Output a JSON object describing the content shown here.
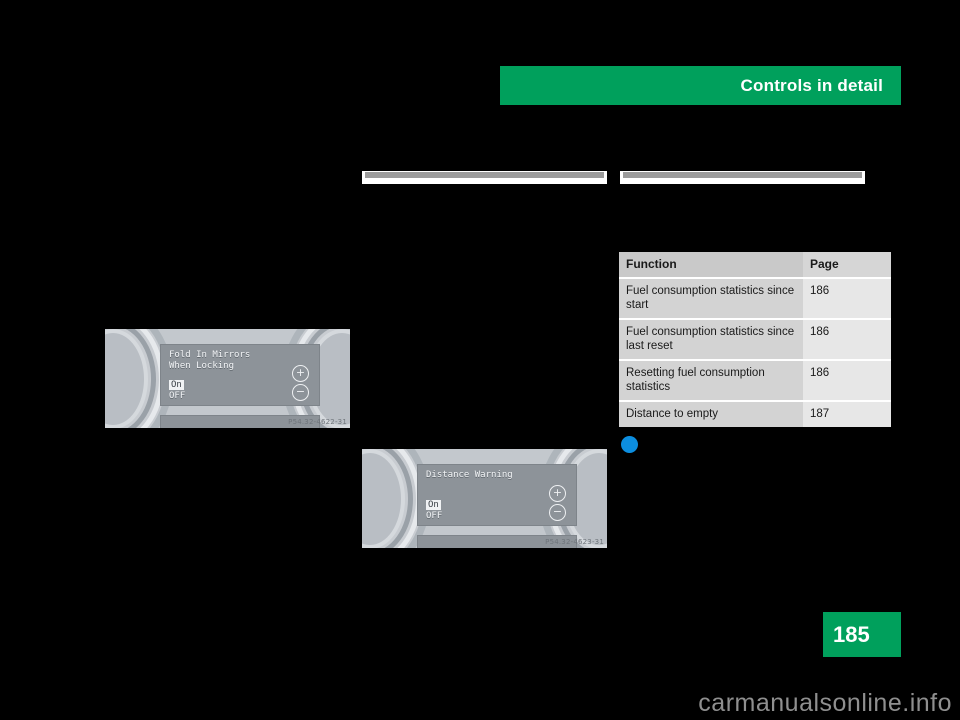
{
  "header": {
    "title": "Controls in detail"
  },
  "rules": {
    "middle_column": "column-rule",
    "right_column": "column-rule"
  },
  "table": {
    "columns": [
      "Function",
      "Page"
    ],
    "rows": [
      {
        "function": "Fuel consumption statistics since start",
        "page": "186"
      },
      {
        "function": "Fuel consumption statistics since last reset",
        "page": "186"
      },
      {
        "function": "Resetting fuel consumption statistics",
        "page": "186"
      },
      {
        "function": "Distance to empty",
        "page": "187"
      }
    ]
  },
  "figures": [
    {
      "name": "fold-in-mirrors-display",
      "lcd_title": "Fold In Mirrors\nWhen Locking",
      "option_selected": "On",
      "option_other": "OFF",
      "button_plus": "+",
      "button_minus": "−",
      "code": "P54.32-4622-31"
    },
    {
      "name": "distance-warning-display",
      "lcd_title": "Distance Warning",
      "option_selected": "On",
      "option_other": "OFF",
      "button_plus": "+",
      "button_minus": "−",
      "code": "P54.32-4623-31"
    }
  ],
  "footer": {
    "page_number": "185",
    "watermark": "carmanualsonline.info"
  },
  "colors": {
    "brand_green": "#00a05c",
    "bullet_blue": "#0c8ee0",
    "table_header": "#c9c9c9",
    "page_background": "#000000"
  }
}
